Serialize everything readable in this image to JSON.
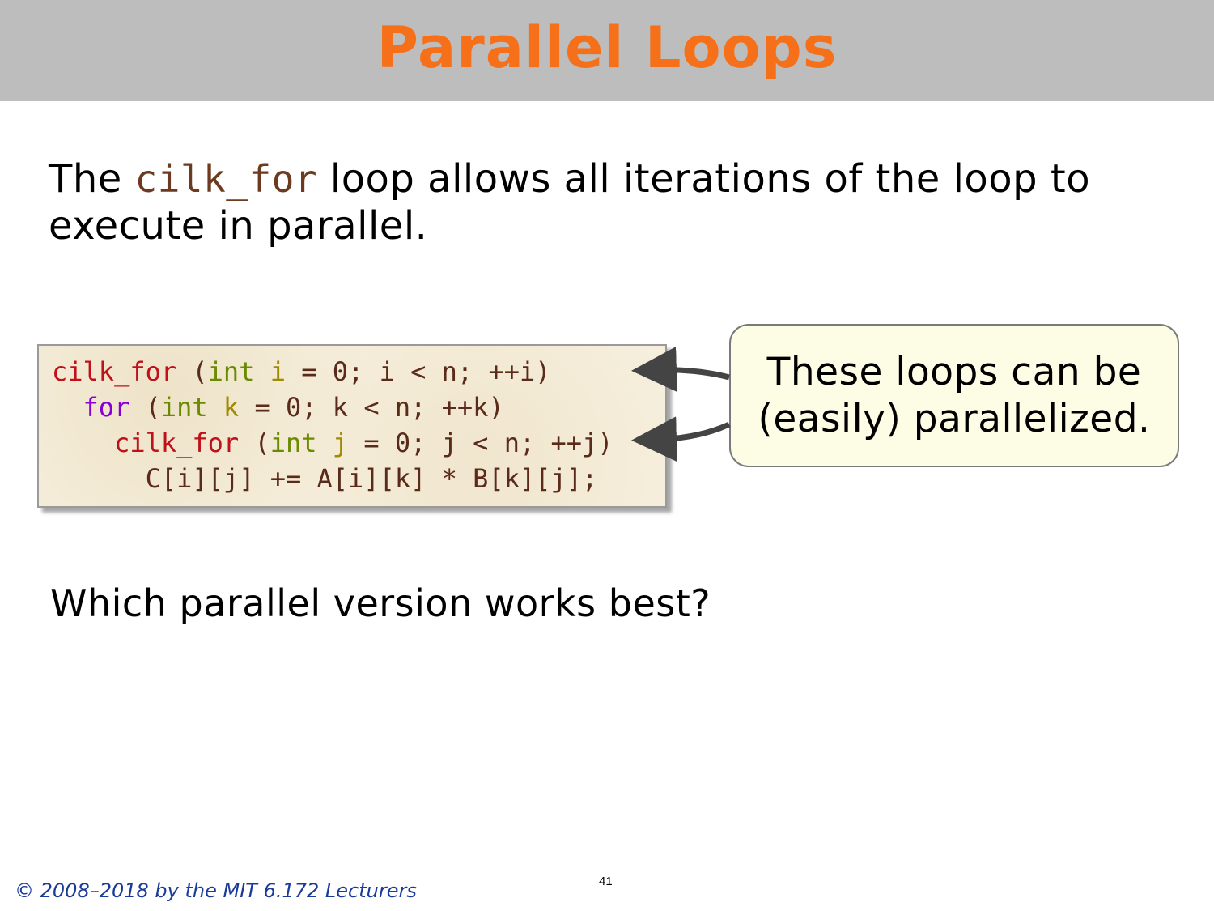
{
  "slide": {
    "title": "Parallel Loops",
    "intro_prefix": "The ",
    "intro_code": "cilk_for",
    "intro_suffix": " loop allows all iterations of the loop to execute in parallel.",
    "code": {
      "line1": {
        "kw": "cilk_for",
        "open": " (",
        "type": "int",
        "var": " i",
        "rest": " = 0; i < n; ++i)"
      },
      "line2": {
        "kw": "for",
        "open": " (",
        "type": "int",
        "var": " k",
        "rest": " = 0; k < n; ++k)"
      },
      "line3": {
        "kw": "cilk_for",
        "open": " (",
        "type": "int",
        "var": " j",
        "rest": " = 0; j < n; ++j)"
      },
      "line4": {
        "text": "C[i][j] += A[i][k] * B[k][j];"
      }
    },
    "callout_line1": "These loops can be",
    "callout_line2": "(easily) parallelized.",
    "question": "Which parallel version works best?",
    "footer": "© 2008–2018 by the MIT 6.172 Lecturers",
    "page_number": "41"
  },
  "colors": {
    "title": "#f57019",
    "title_bar": "#bdbdbd",
    "keyword_cilk": "#c0101a",
    "keyword_for": "#8a00d4",
    "type": "#6a8a00",
    "footer": "#1a3a9a"
  }
}
